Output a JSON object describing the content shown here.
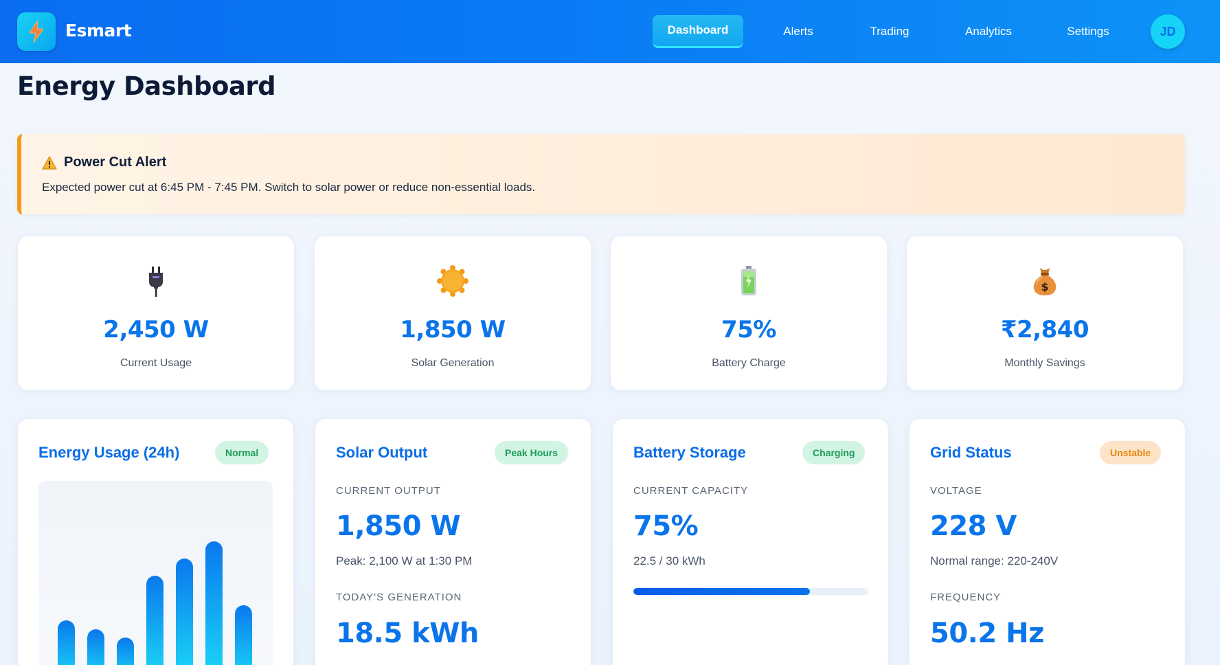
{
  "header": {
    "brand": "Esmart",
    "logo_icon": "lightning-bolt-icon",
    "nav": [
      {
        "label": "Dashboard",
        "active": true
      },
      {
        "label": "Alerts",
        "active": false
      },
      {
        "label": "Trading",
        "active": false
      },
      {
        "label": "Analytics",
        "active": false
      },
      {
        "label": "Settings",
        "active": false
      }
    ],
    "avatar_initials": "JD"
  },
  "page_title": "Energy Dashboard",
  "alert": {
    "icon": "warning-icon",
    "title": "Power Cut Alert",
    "message": "Expected power cut at 6:45 PM - 7:45 PM. Switch to solar power or reduce non-essential loads."
  },
  "stats": [
    {
      "icon": "plug-icon",
      "value": "2,450 W",
      "label": "Current Usage"
    },
    {
      "icon": "sun-icon",
      "value": "1,850 W",
      "label": "Solar Generation"
    },
    {
      "icon": "battery-icon",
      "value": "75%",
      "label": "Battery Charge"
    },
    {
      "icon": "money-bag-icon",
      "value": "₹2,840",
      "label": "Monthly Savings"
    }
  ],
  "panels": {
    "usage": {
      "title": "Energy Usage (24h)",
      "badge": "Normal",
      "chart_data": {
        "type": "bar",
        "values": [
          0.42,
          0.36,
          0.3,
          0.74,
          0.86,
          0.98,
          0.53
        ],
        "ylim": [
          0,
          1
        ]
      }
    },
    "solar": {
      "title": "Solar Output",
      "badge": "Peak Hours",
      "current_label": "CURRENT OUTPUT",
      "current_value": "1,850 W",
      "peak_text": "Peak: 2,100 W at 1:30 PM",
      "today_label": "TODAY'S GENERATION",
      "today_value": "18.5 kWh"
    },
    "battery": {
      "title": "Battery Storage",
      "badge": "Charging",
      "capacity_label": "CURRENT CAPACITY",
      "capacity_value": "75%",
      "capacity_detail": "22.5 / 30 kWh",
      "fill_fraction": 0.75
    },
    "grid": {
      "title": "Grid Status",
      "badge": "Unstable",
      "voltage_label": "VOLTAGE",
      "voltage_value": "228 V",
      "voltage_range": "Normal range: 220-240V",
      "frequency_label": "FREQUENCY",
      "frequency_value": "50.2 Hz"
    }
  },
  "colors": {
    "header_gradient_start": "#0a6df0",
    "accent_blue": "#0a74eb",
    "alert_border": "#f39a1b",
    "badge_green_bg": "#d2f4e3",
    "badge_orange_bg": "#fde3c7"
  }
}
